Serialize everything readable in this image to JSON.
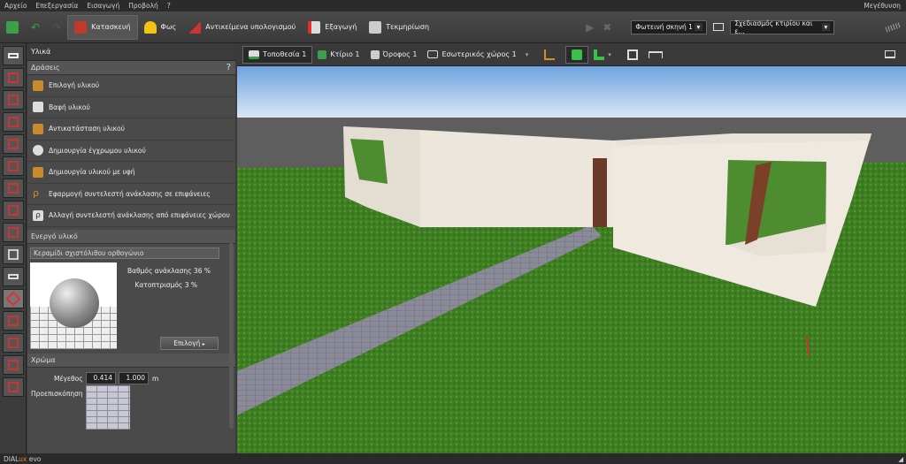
{
  "menu": {
    "items": [
      "Αρχείο",
      "Επεξεργασία",
      "Εισαγωγή",
      "Προβολή",
      "?"
    ],
    "right": "Μεγέθυνση"
  },
  "toolbar": {
    "tabs": [
      {
        "label": "Κατασκευή",
        "icon": "construction-icon",
        "color": "#c0392b"
      },
      {
        "label": "Φως",
        "icon": "light-icon",
        "color": "#f1c40f"
      },
      {
        "label": "Αντικείμενα υπολογισμού",
        "icon": "calc-objects-icon",
        "color": "#d9d9d9"
      },
      {
        "label": "Εξαγωγή",
        "icon": "export-icon",
        "color": "#e03030"
      },
      {
        "label": "Τεκμηρίωση",
        "icon": "documentation-icon",
        "color": "#cccccc"
      }
    ],
    "scene_select": "Φωτεινή σκηνή 1",
    "design_select": "Σχεδιασμός κτιρίου και ε..."
  },
  "panel": {
    "title": "Υλικά",
    "actions_header": "Δράσεις",
    "help": "?",
    "actions": [
      "Επιλογή υλικού",
      "Βαφή υλικού",
      "Αντικατάσταση υλικού",
      "Δημιουργία έγχρωμου υλικού",
      "Δημιουργία υλικού με υφή",
      "Εφαρμογή συντελεστή ανάκλασης σε επιφάνειες",
      "Αλλαγή συντελεστή ανάκλασης από επιφάνειες χώρου"
    ],
    "active_header": "Ενεργό υλικό",
    "material_name": "Κεραμίδι σχιστόλιθου ορθογώνιο",
    "reflection": "Βαθμός ανάκλασης 36 %",
    "mirror": "Κατοπτρισμός 3 %",
    "select_btn": "Επιλογή",
    "color_header": "Χρώμα",
    "size_label": "Μέγεθος",
    "size_w": "0.414",
    "size_h": "1.000",
    "size_unit": "m",
    "preview_label": "Προεπισκόπηση"
  },
  "viewbar": {
    "items": [
      "Τοποθεσία 1",
      "Κτίριο 1",
      "Όροφος 1",
      "Εσωτερικός χώρος 1"
    ]
  },
  "status": {
    "brand_a": "DIAL",
    "brand_b": "ux",
    "brand_c": " evo"
  }
}
